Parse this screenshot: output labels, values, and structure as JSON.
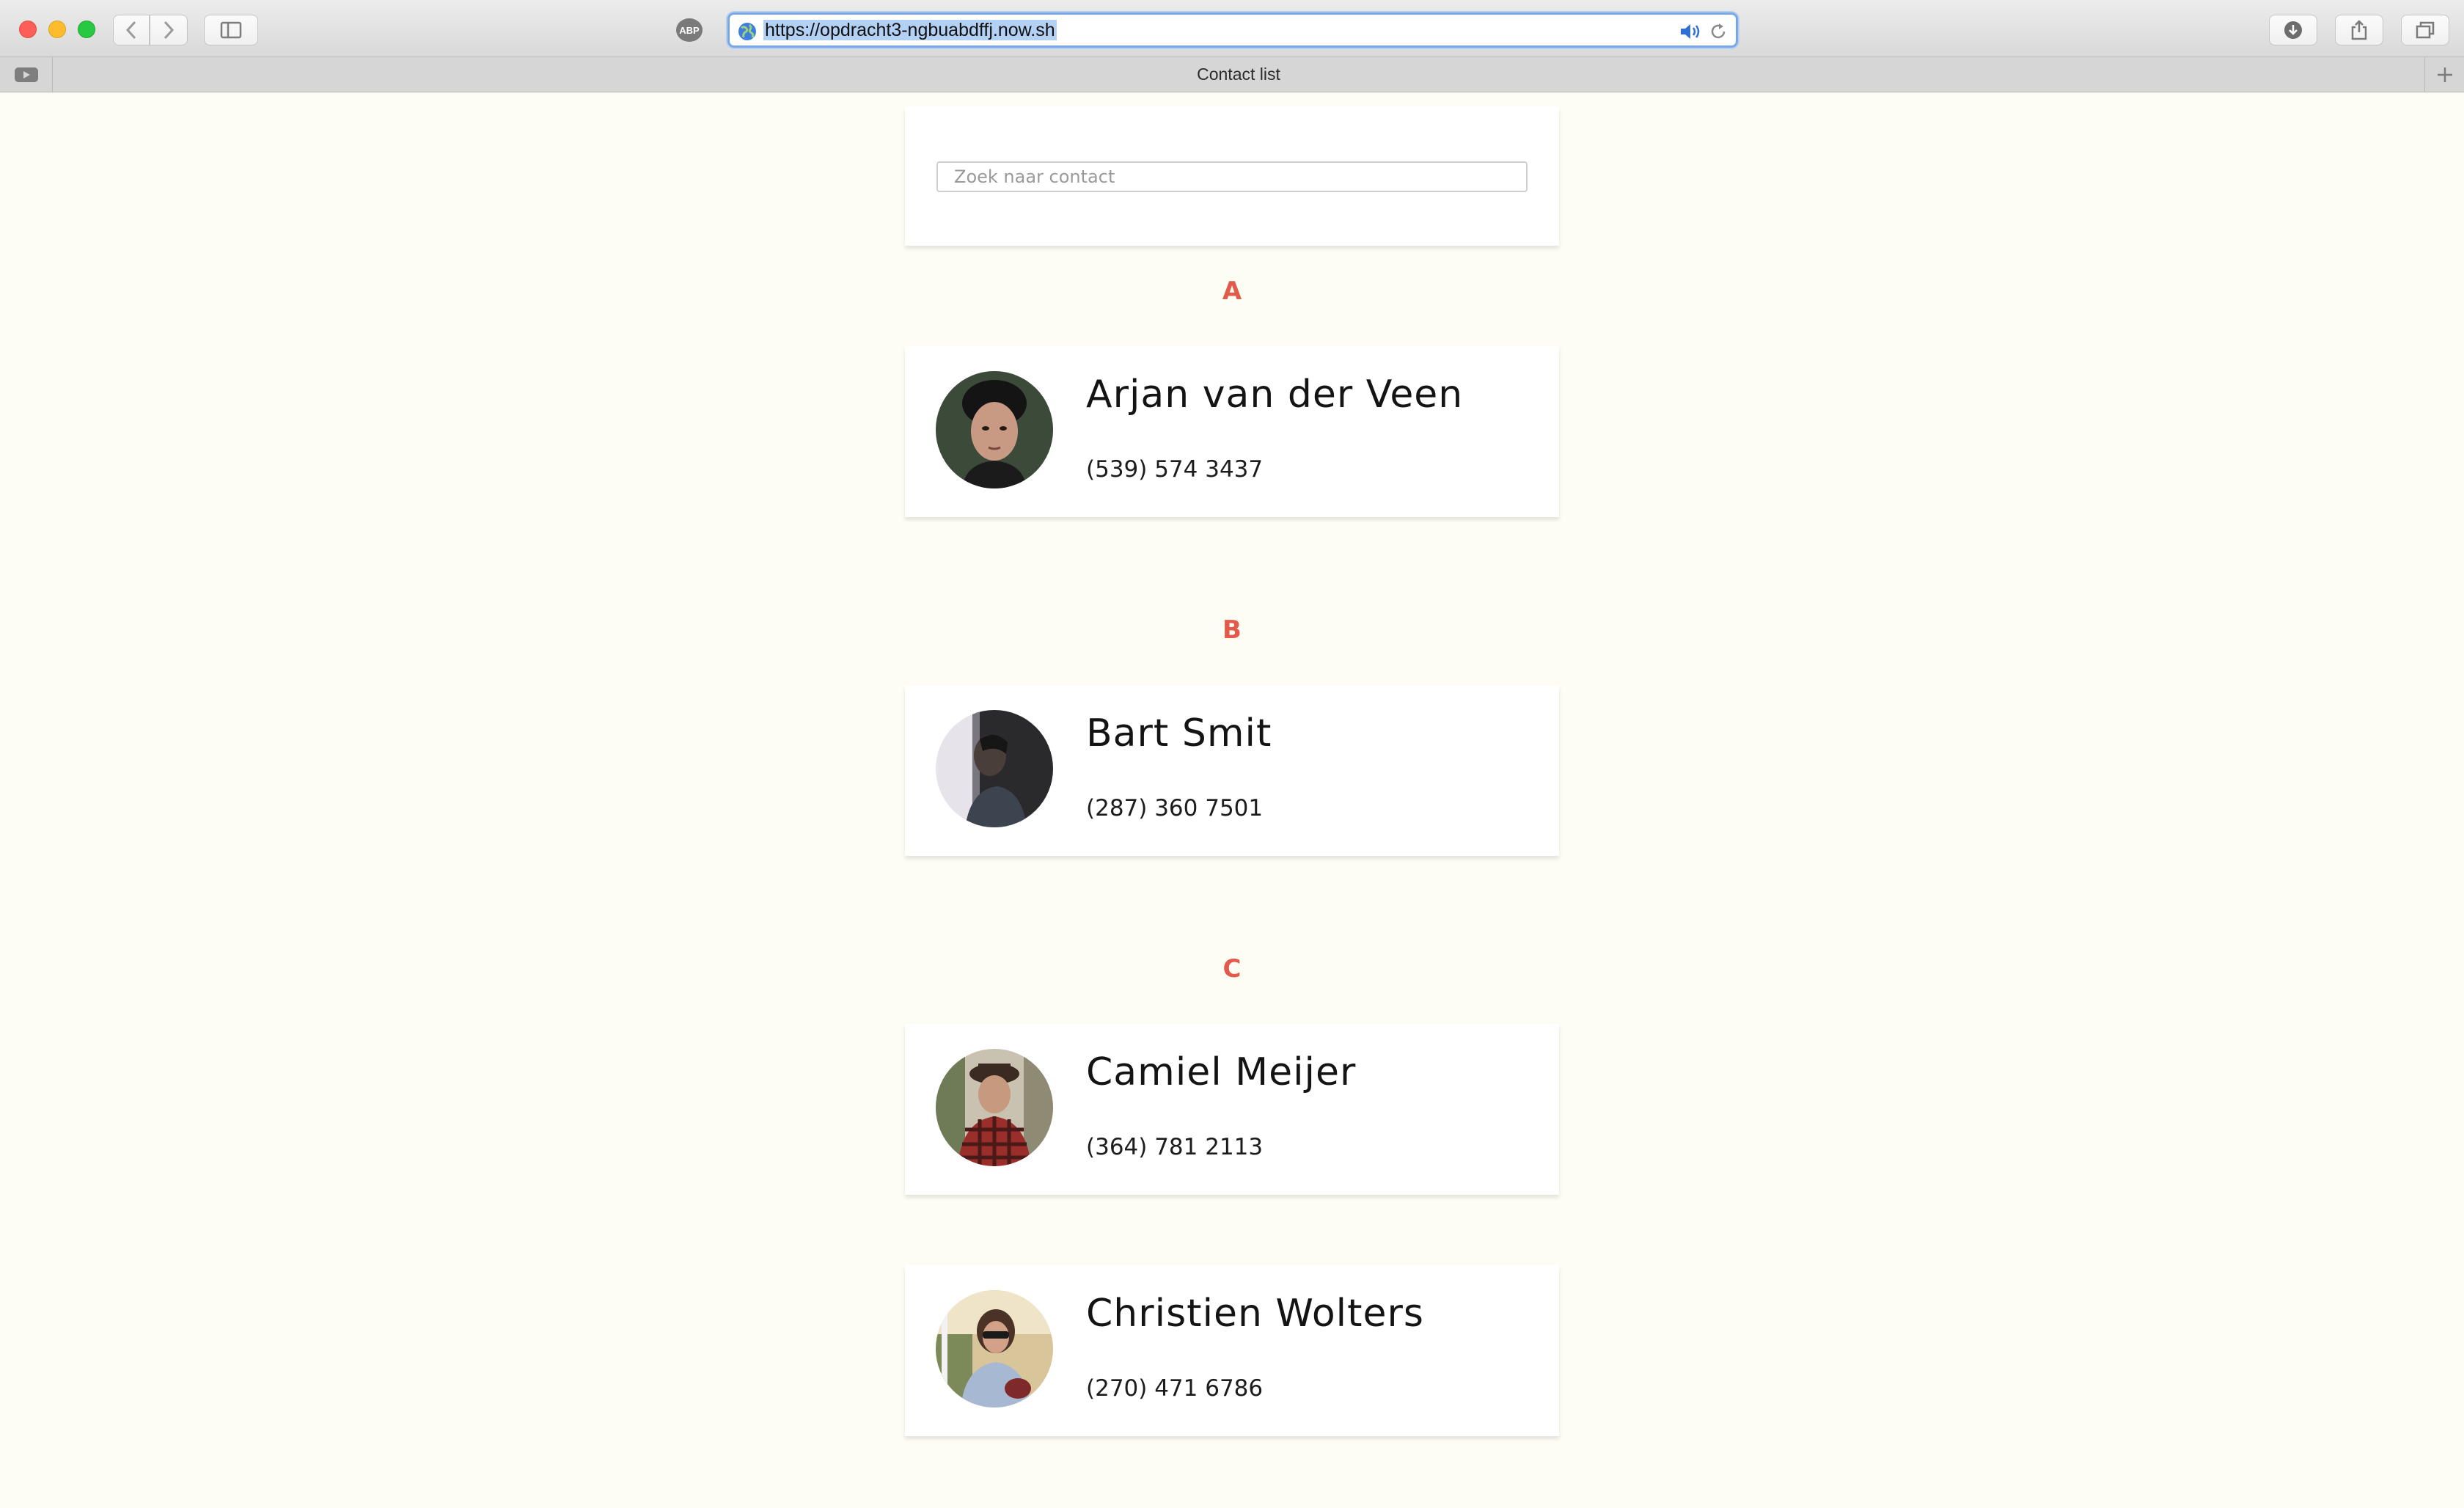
{
  "browser": {
    "url": "https://opdracht3-ngbuabdffj.now.sh",
    "tab_title": "Contact list",
    "adblock_label": "ABP"
  },
  "search": {
    "placeholder": "Zoek naar contact",
    "value": ""
  },
  "groups": [
    {
      "letter": "A",
      "contacts": [
        {
          "name": "Arjan van der Veen",
          "phone": "(539) 574 3437"
        }
      ]
    },
    {
      "letter": "B",
      "contacts": [
        {
          "name": "Bart Smit",
          "phone": "(287) 360 7501"
        }
      ]
    },
    {
      "letter": "C",
      "contacts": [
        {
          "name": "Camiel Meijer",
          "phone": "(364) 781 2113"
        },
        {
          "name": "Christien Wolters",
          "phone": "(270) 471 6786"
        }
      ]
    }
  ],
  "colors": {
    "page_background": "#fdfdf4",
    "letter_accent": "#e25a4c",
    "card_background": "#ffffff"
  }
}
